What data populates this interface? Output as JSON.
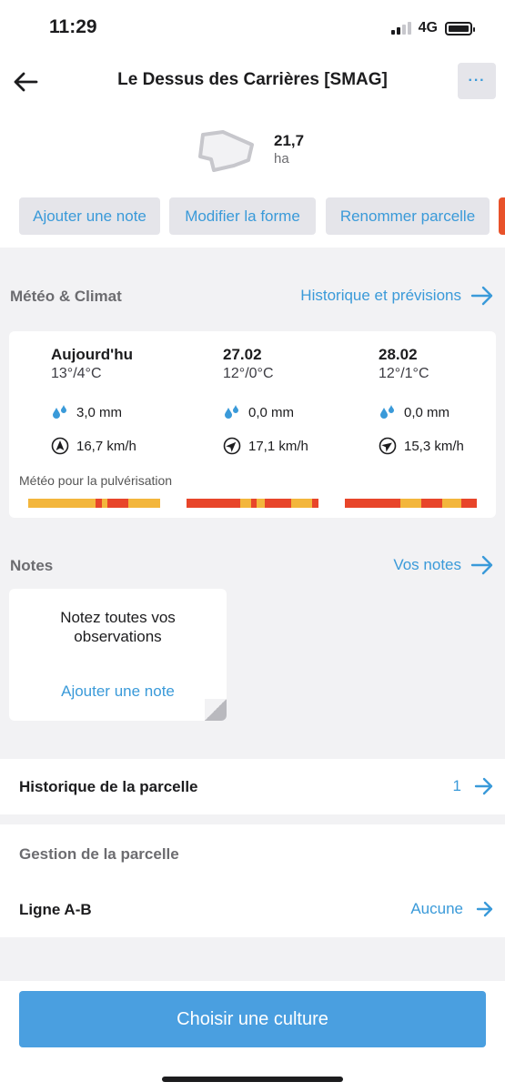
{
  "status_bar": {
    "time": "11:29",
    "network": "4G"
  },
  "header": {
    "title": "Le Dessus des Carrières [SMAG]",
    "more_label": "···"
  },
  "parcel": {
    "area_value": "21,7",
    "area_unit": "ha"
  },
  "actions": [
    {
      "label": "Ajouter une note"
    },
    {
      "label": "Modifier la forme"
    },
    {
      "label": "Renommer parcelle"
    }
  ],
  "weather": {
    "section_title": "Météo & Climat",
    "link_label": "Historique et prévisions",
    "days": [
      {
        "label": "Aujourd'hu",
        "temp": "13°/4°C",
        "rain": "3,0 mm",
        "wind": "16,7 km/h"
      },
      {
        "label": "27.02",
        "temp": "12°/0°C",
        "rain": "0,0 mm",
        "wind": "17,1 km/h"
      },
      {
        "label": "28.02",
        "temp": "12°/1°C",
        "rain": "0,0 mm",
        "wind": "15,3 km/h"
      }
    ],
    "spray_label": "Météo pour la pulvérisation",
    "colors": {
      "good": "#f3b63c",
      "bad": "#e8452a"
    }
  },
  "notes": {
    "section_title": "Notes",
    "link_label": "Vos notes",
    "empty_text": "Notez toutes vos observations",
    "add_label": "Ajouter une note"
  },
  "history": {
    "label": "Historique de la parcelle",
    "count": "1"
  },
  "management": {
    "section_title": "Gestion de la parcelle",
    "ab_line_label": "Ligne A-B",
    "ab_line_value": "Aucune"
  },
  "cta": {
    "label": "Choisir une culture"
  },
  "colors": {
    "accent": "#3a9ad9",
    "cta": "#4a9fe0",
    "background": "#f2f2f4"
  }
}
